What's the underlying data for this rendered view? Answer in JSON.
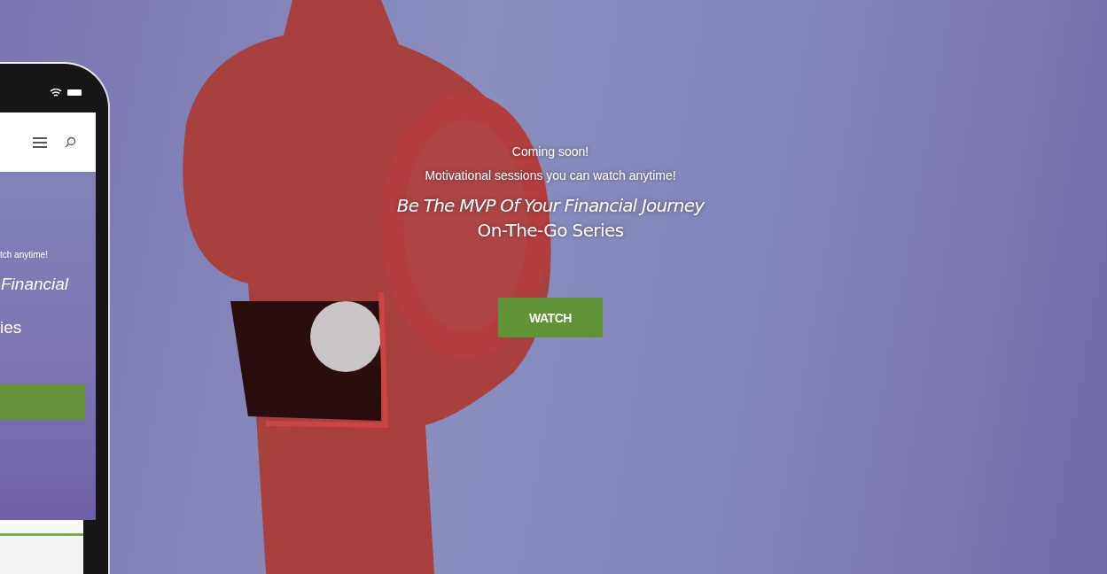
{
  "hero": {
    "announcement": "Coming soon!",
    "subtitle": "Motivational sessions you can watch anytime!",
    "title": "Be The MVP Of Your Financial Journey",
    "series": "On-The-Go Series",
    "button": "WATCH"
  },
  "phone_preview": {
    "subtitle": "tch anytime!",
    "title": "Financial",
    "series": "ies"
  }
}
